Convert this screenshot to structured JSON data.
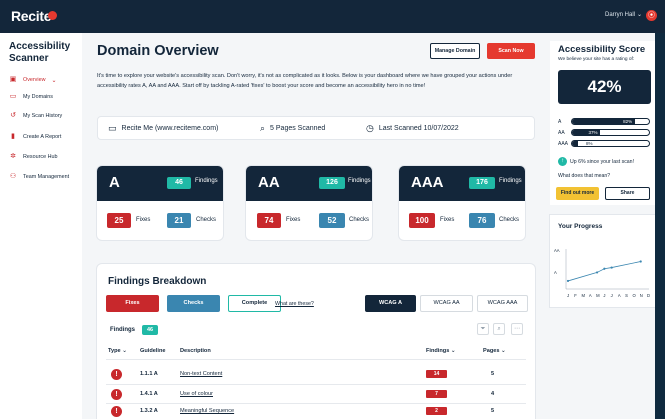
{
  "topbar": {
    "logo": "Recite",
    "logo_badge": "me",
    "user": "Darryn Hall",
    "caret": "⌄"
  },
  "sidebar": {
    "title": "Accessibility Scanner",
    "items": [
      {
        "label": "Overview",
        "icon": "calendar-icon",
        "active": true
      },
      {
        "label": "My Domains",
        "icon": "monitor-icon"
      },
      {
        "label": "My Scan History",
        "icon": "history-icon"
      },
      {
        "label": "Create A Report",
        "icon": "chart-icon"
      },
      {
        "label": "Resource Hub",
        "icon": "gear-icon"
      },
      {
        "label": "Team Management",
        "icon": "team-icon"
      }
    ]
  },
  "main": {
    "title": "Domain Overview",
    "manage_btn": "Manage Domain",
    "scan_btn": "Scan Now",
    "intro": "It's time to explore your website's accessibility scan. Don't worry, it's not as complicated as it looks. Below is your dashboard where we have grouped your actions under accessibility rates A, AA and AAA. Start off by tackling A-rated 'fixes' to boost your score and become an accessibility hero in no time!",
    "info": {
      "site": "Recite Me (www.reciteme.com)",
      "pages": "5 Pages Scanned",
      "last": "Last Scanned 10/07/2022"
    },
    "cards": [
      {
        "level": "A",
        "findings": "46",
        "findings_label": "Findings",
        "fixes": "25",
        "fixes_label": "Fixes",
        "checks": "21",
        "checks_label": "Checks"
      },
      {
        "level": "AA",
        "findings": "126",
        "findings_label": "Findings",
        "fixes": "74",
        "fixes_label": "Fixes",
        "checks": "52",
        "checks_label": "Checks"
      },
      {
        "level": "AAA",
        "findings": "176",
        "findings_label": "Findings",
        "fixes": "100",
        "fixes_label": "Fixes",
        "checks": "76",
        "checks_label": "Checks"
      }
    ]
  },
  "breakdown": {
    "title": "Findings Breakdown",
    "fixes": "Fixes",
    "checks": "Checks",
    "complete": "Complete",
    "what": "What are these?",
    "wcag": [
      "WCAG A",
      "WCAG AA",
      "WCAG AAA"
    ],
    "findings_label": "Findings",
    "findings_count": "46",
    "headers": {
      "type": "Type ⌄",
      "guideline": "Guideline",
      "description": "Description",
      "findings": "Findings ⌄",
      "pages": "Pages ⌄"
    },
    "rows": [
      {
        "guideline": "1.1.1 A",
        "description": "Non-text Content",
        "findings": "14",
        "pages": "5"
      },
      {
        "guideline": "1.4.1 A",
        "description": "Use of colour",
        "findings": "7",
        "pages": "4"
      },
      {
        "guideline": "1.3.2 A",
        "description": "Meaningful Sequence",
        "findings": "2",
        "pages": "5"
      }
    ]
  },
  "score": {
    "title": "Accessibility Score",
    "subtitle": "We believe your site has a rating of:",
    "value": "42%",
    "bars": [
      {
        "label": "A",
        "value": 0.82,
        "text": "82%"
      },
      {
        "label": "AA",
        "value": 0.37,
        "text": "37%"
      },
      {
        "label": "AAA",
        "value": 0.08,
        "text": "8%"
      }
    ],
    "up_text": "Up 6% since your last scan!",
    "what": "What does that mean?",
    "find_btn": "Find out more",
    "share_btn": "Share"
  },
  "chart_data": {
    "type": "line",
    "title": "Your Progress",
    "categories": [
      "J",
      "F",
      "M",
      "A",
      "M",
      "J",
      "J",
      "A",
      "S",
      "O",
      "N",
      "D"
    ],
    "y_ticks": [
      "AA",
      "A"
    ],
    "values": [
      1.05,
      null,
      null,
      null,
      1.4,
      1.55,
      1.6,
      null,
      null,
      null,
      1.85,
      null
    ]
  }
}
